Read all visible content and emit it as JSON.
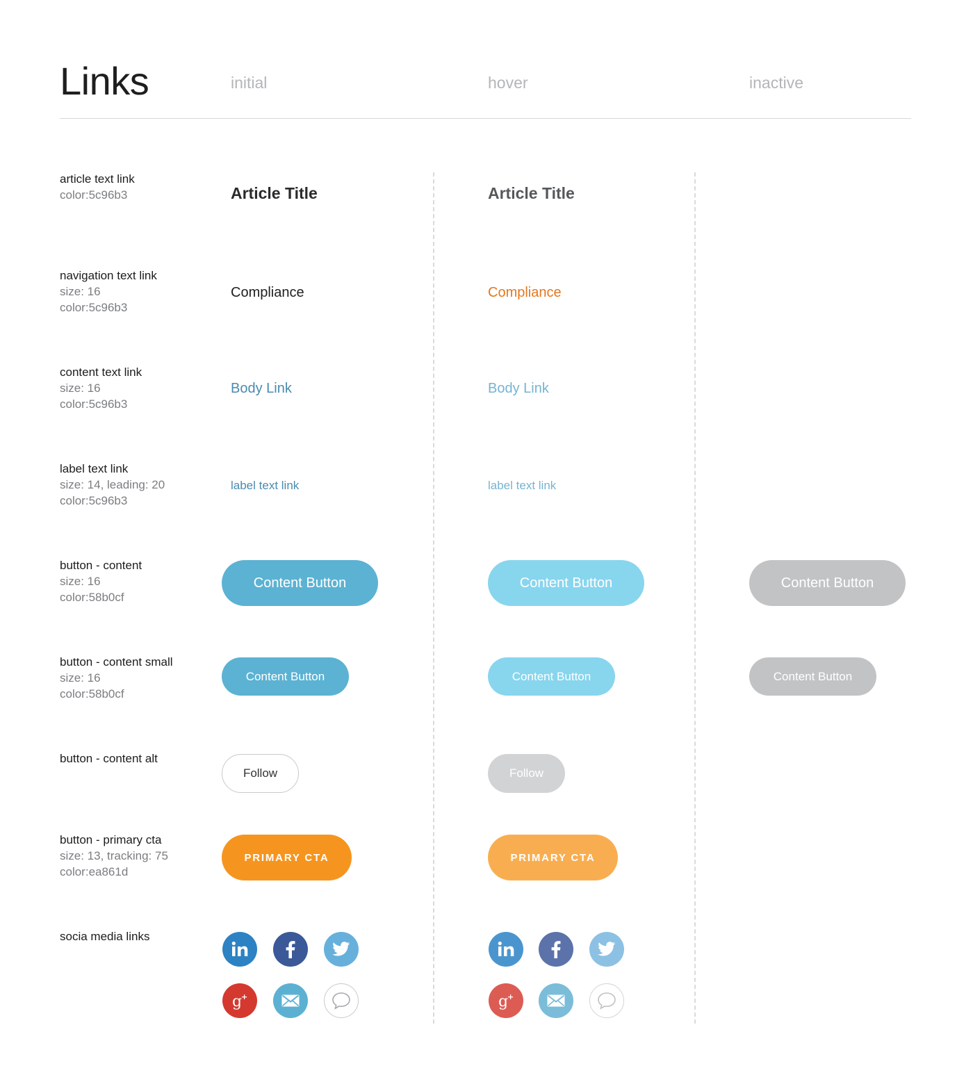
{
  "header": {
    "title": "Links",
    "columns": [
      "initial",
      "hover",
      "inactive"
    ]
  },
  "rows": {
    "article": {
      "name": "article text link",
      "meta": [
        "color:5c96b3"
      ],
      "initial_text": "Article Title",
      "hover_text": "Article Title"
    },
    "navigation": {
      "name": "navigation text link",
      "meta": [
        "size: 16",
        "color:5c96b3"
      ],
      "initial_text": "Compliance",
      "hover_text": "Compliance"
    },
    "content": {
      "name": "content text link",
      "meta": [
        "size: 16",
        "color:5c96b3"
      ],
      "initial_text": "Body Link",
      "hover_text": "Body Link"
    },
    "label": {
      "name": "label text link",
      "meta": [
        "size: 14, leading: 20",
        "color:5c96b3"
      ],
      "initial_text": "label text link",
      "hover_text": "label text link"
    },
    "button_content": {
      "name": "button - content",
      "meta": [
        "size: 16",
        "color:58b0cf"
      ],
      "initial_label": "Content Button",
      "hover_label": "Content Button",
      "inactive_label": "Content Button"
    },
    "button_content_small": {
      "name": "button - content small",
      "meta": [
        "size: 16",
        "color:58b0cf"
      ],
      "initial_label": "Content Button",
      "hover_label": "Content Button",
      "inactive_label": "Content Button"
    },
    "button_content_alt": {
      "name": "button - content alt",
      "initial_label": "Follow",
      "hover_label": "Follow"
    },
    "button_primary_cta": {
      "name": "button - primary cta",
      "meta": [
        "size: 13, tracking: 75",
        "color:ea861d"
      ],
      "initial_label": "PRIMARY CTA",
      "hover_label": "PRIMARY CTA"
    },
    "social": {
      "name": "socia media links",
      "icons": [
        "linkedin-icon",
        "facebook-icon",
        "twitter-icon",
        "google-plus-icon",
        "email-icon",
        "comment-icon"
      ]
    }
  },
  "colors": {
    "article_initial": "#2a2b2d",
    "article_hover": "#55585c",
    "nav_initial": "#1f1f1f",
    "nav_hover": "#e3781f",
    "link_initial": "#4a8bb0",
    "link_hover": "#76b4d1",
    "btn_initial": "#5cb2d2",
    "btn_hover": "#88d5ee",
    "btn_inactive": "#c2c3c5",
    "follow_initial_border": "#c8c9cb",
    "follow_initial_text": "#333333",
    "follow_hover_bg": "#d2d3d5",
    "cta_initial": "#f5951f",
    "cta_hover": "#f8ae50",
    "linkedin": "#2c82c3",
    "facebook": "#3b5998",
    "twitter": "#67b0dc",
    "google_plus": "#d4392f",
    "email": "#5cb1d2",
    "comment_border": "#c8c9cb"
  }
}
